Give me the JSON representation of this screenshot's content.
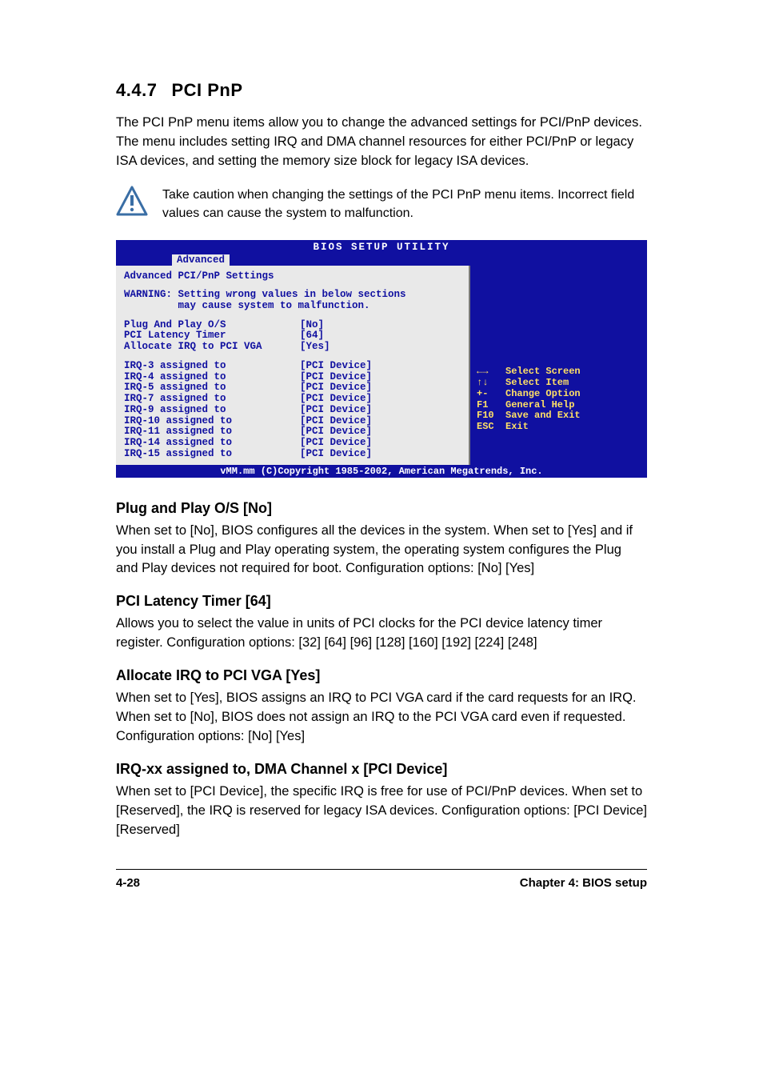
{
  "section": {
    "number": "4.4.7",
    "title": "PCI PnP"
  },
  "intro": "The PCI PnP menu items allow you to change the advanced settings for PCI/PnP devices. The menu includes setting IRQ and DMA channel resources for either PCI/PnP or legacy ISA devices, and setting the memory size block for legacy ISA devices.",
  "caution": "Take caution when changing the settings of the PCI PnP menu items. Incorrect field values can cause the system to malfunction.",
  "bios": {
    "title": "BIOS SETUP UTILITY",
    "tab": "Advanced",
    "panel_title": "Advanced PCI/PnP Settings",
    "warning_l1": "WARNING: Setting wrong values in below sections",
    "warning_l2": "         may cause system to malfunction.",
    "settings": [
      {
        "label": "Plug And Play O/S",
        "value": "[No]"
      },
      {
        "label": "PCI Latency Timer",
        "value": "[64]"
      },
      {
        "label": "Allocate IRQ to PCI VGA",
        "value": "[Yes]"
      }
    ],
    "irq": [
      {
        "label": "IRQ-3 assigned to",
        "value": "[PCI Device]"
      },
      {
        "label": "IRQ-4 assigned to",
        "value": "[PCI Device]"
      },
      {
        "label": "IRQ-5 assigned to",
        "value": "[PCI Device]"
      },
      {
        "label": "IRQ-7 assigned to",
        "value": "[PCI Device]"
      },
      {
        "label": "IRQ-9 assigned to",
        "value": "[PCI Device]"
      },
      {
        "label": "IRQ-10 assigned to",
        "value": "[PCI Device]"
      },
      {
        "label": "IRQ-11 assigned to",
        "value": "[PCI Device]"
      },
      {
        "label": "IRQ-14 assigned to",
        "value": "[PCI Device]"
      },
      {
        "label": "IRQ-15 assigned to",
        "value": "[PCI Device]"
      }
    ],
    "help": [
      {
        "key": "←→",
        "label": "Select Screen"
      },
      {
        "key": "↑↓",
        "label": "Select Item"
      },
      {
        "key": "+-",
        "label": "Change Option"
      },
      {
        "key": "F1",
        "label": "General Help"
      },
      {
        "key": "F10",
        "label": "Save and Exit"
      },
      {
        "key": "ESC",
        "label": "Exit"
      }
    ],
    "footer": "vMM.mm (C)Copyright 1985-2002, American Megatrends, Inc."
  },
  "subs": {
    "pnp": {
      "heading": "Plug and Play O/S [No]",
      "body": "When set to [No], BIOS configures all the devices in the system. When set to [Yes] and if you install a Plug and Play operating system, the operating system configures the Plug and Play devices not required for boot. Configuration options: [No] [Yes]"
    },
    "latency": {
      "heading": "PCI Latency Timer [64]",
      "body": "Allows you to select the value in units of PCI clocks for the PCI device latency timer register. Configuration options: [32] [64] [96] [128] [160] [192] [224] [248]"
    },
    "irqvga": {
      "heading": "Allocate IRQ to PCI VGA [Yes]",
      "body": "When set to [Yes], BIOS assigns an IRQ to PCI VGA card if the card requests for an IRQ. When set to [No], BIOS does not assign an IRQ to the PCI VGA card even if requested. Configuration options: [No] [Yes]"
    },
    "irqxx": {
      "heading": "IRQ-xx assigned to, DMA Channel x [PCI Device]",
      "body": "When set to [PCI Device], the specific IRQ is free for use of PCI/PnP devices. When set to [Reserved], the IRQ is reserved for legacy ISA devices. Configuration options: [PCI Device] [Reserved]"
    }
  },
  "footer": {
    "page": "4-28",
    "chapter": "Chapter 4: BIOS setup"
  }
}
